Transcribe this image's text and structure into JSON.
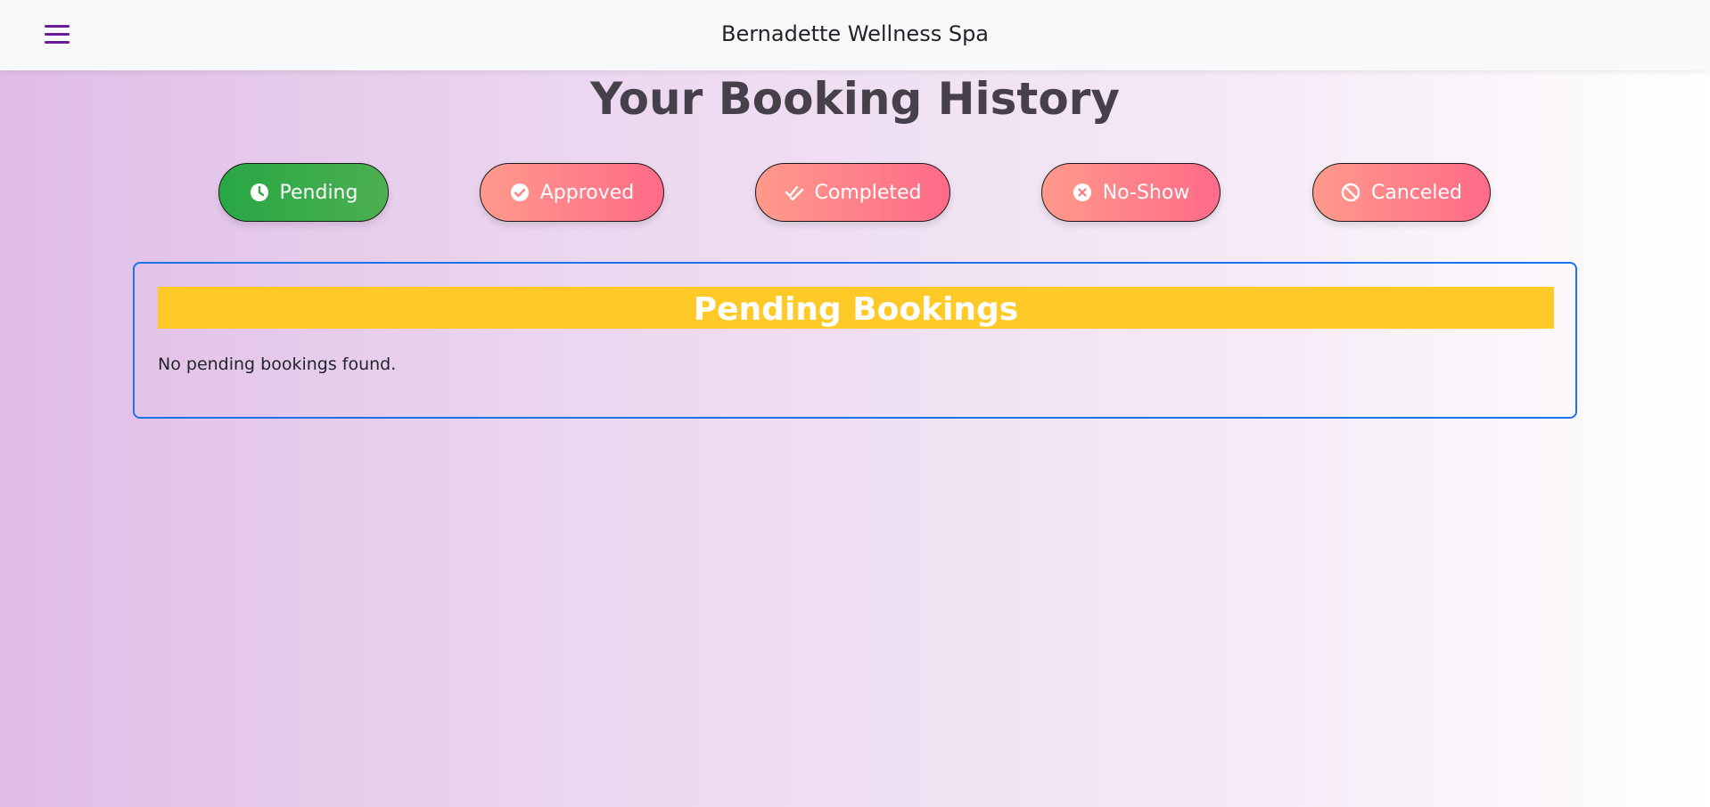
{
  "navbar": {
    "menu_icon": "hamburger-menu-icon",
    "brand": "Bernadette Wellness Spa"
  },
  "page": {
    "title": "Your Booking History"
  },
  "filters": [
    {
      "label": "Pending",
      "icon": "clock-icon",
      "active": true
    },
    {
      "label": "Approved",
      "icon": "check-circle-icon",
      "active": false
    },
    {
      "label": "Completed",
      "icon": "double-check-icon",
      "active": false
    },
    {
      "label": "No-Show",
      "icon": "x-circle-icon",
      "active": false
    },
    {
      "label": "Canceled",
      "icon": "ban-icon",
      "active": false
    }
  ],
  "panel": {
    "heading": "Pending Bookings",
    "empty_message": "No pending bookings found."
  },
  "colors": {
    "active_filter": "#28a745",
    "inactive_filter": "#ff6a88",
    "heading_band": "#ffca28",
    "panel_border": "#1a73e8",
    "menu_icon": "#6a1b9a"
  }
}
